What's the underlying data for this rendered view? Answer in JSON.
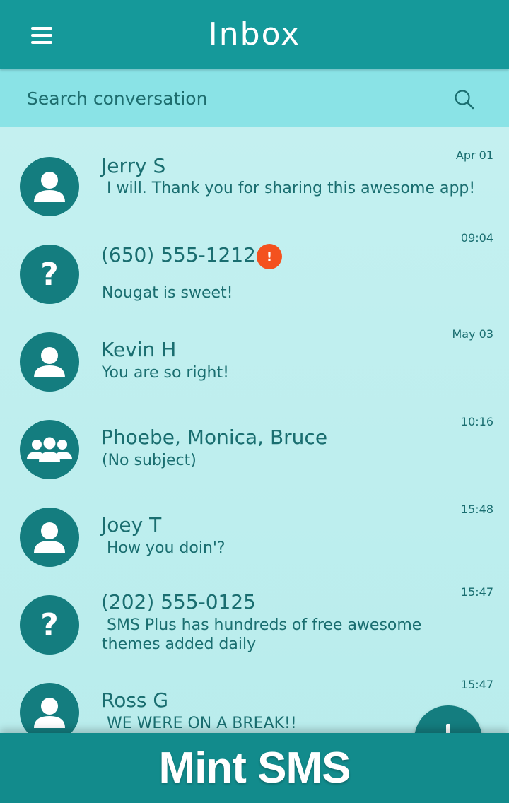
{
  "header": {
    "title": "Inbox",
    "menu_icon": "hamburger-menu-icon"
  },
  "search": {
    "placeholder": "Search conversation",
    "icon": "search-icon"
  },
  "conversations": [
    {
      "name": "Jerry S",
      "preview": "I will. Thank you for sharing this awesome app!",
      "time": "Apr 01",
      "avatar": "person-icon"
    },
    {
      "name": "(650) 555-1212",
      "preview": "Nougat is sweet!",
      "time": "09:04",
      "avatar": "question-mark-icon",
      "badge": "!"
    },
    {
      "name": "Kevin H",
      "preview": "You are so right!",
      "time": "May 03",
      "avatar": "person-icon"
    },
    {
      "name": "Phoebe, Monica, Bruce",
      "preview": "(No subject)",
      "time": "10:16",
      "avatar": "group-icon"
    },
    {
      "name": "Joey T",
      "preview": "How you doin'?",
      "time": "15:48",
      "avatar": "person-icon"
    },
    {
      "name": "(202) 555-0125",
      "preview": "SMS Plus has hundreds of free awesome themes added daily",
      "time": "15:47",
      "avatar": "question-mark-icon"
    },
    {
      "name": "Ross G",
      "preview": "WE WERE ON A BREAK!!",
      "time": "15:47",
      "avatar": "person-icon"
    }
  ],
  "fab": {
    "icon": "plus-icon"
  },
  "footer": {
    "title": "Mint SMS"
  },
  "colors": {
    "appbar": "#15999a",
    "searchbar": "#8ae3e6",
    "avatar": "#147d7f",
    "text": "#1a6e70",
    "badge": "#f4511e",
    "footer": "#128b8c"
  }
}
